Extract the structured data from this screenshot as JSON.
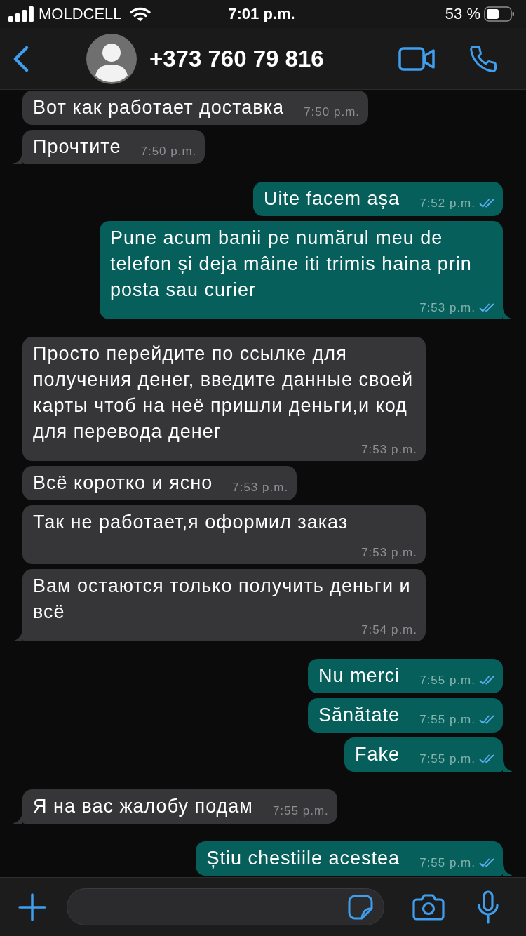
{
  "status_bar": {
    "carrier": "MOLDCELL",
    "time": "7:01 p.m.",
    "battery": "53 %"
  },
  "header": {
    "contact": "+373 760 79 816"
  },
  "messages": [
    {
      "kind": "incoming",
      "text": "Вот как работает доставка",
      "time": "7:50 p.m.",
      "tail": false
    },
    {
      "kind": "incoming",
      "text": "Прочтите",
      "time": "7:50 p.m.",
      "tail": true
    },
    {
      "kind": "outgoing",
      "text": "Uite facem așa",
      "time": "7:52 p.m.",
      "read": true,
      "tail": false
    },
    {
      "kind": "outgoing",
      "text": "Pune acum banii pe numărul meu de telefon și deja mâine iti trimis haina prin posta sau curier",
      "time": "7:53 p.m.",
      "read": true,
      "tail": true
    },
    {
      "kind": "incoming",
      "text": "Просто перейдите по ссылке для получения денег, введите данные своей карты чтоб на неё пришли деньги,и код для перевода денег",
      "time": "7:53 p.m.",
      "tail": false
    },
    {
      "kind": "incoming",
      "text": "Всё коротко и ясно",
      "time": "7:53 p.m.",
      "tail": false
    },
    {
      "kind": "incoming",
      "text": "Так не работает,я оформил заказ",
      "time": "7:53 p.m.",
      "tail": false
    },
    {
      "kind": "incoming",
      "text": "Вам остаются только получить деньги и всё",
      "time": "7:54 p.m.",
      "tail": true
    },
    {
      "kind": "outgoing",
      "text": "Nu merci",
      "time": "7:55 p.m.",
      "read": true,
      "tail": false
    },
    {
      "kind": "outgoing",
      "text": "Sănătate",
      "time": "7:55 p.m.",
      "read": true,
      "tail": false
    },
    {
      "kind": "outgoing",
      "text": "Fake",
      "time": "7:55 p.m.",
      "read": true,
      "tail": true
    },
    {
      "kind": "incoming",
      "text": "Я на вас жалобу подам",
      "time": "7:55 p.m.",
      "tail": true
    },
    {
      "kind": "outgoing",
      "text": "Știu chestiile acestea",
      "time": "7:55 p.m.",
      "read": true,
      "tail": true
    }
  ]
}
